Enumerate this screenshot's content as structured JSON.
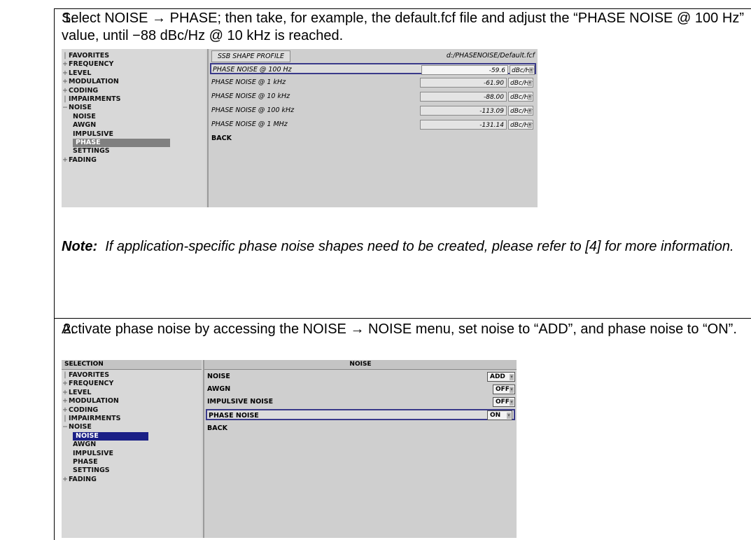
{
  "steps": [
    {
      "number": "1.",
      "text": "Select NOISE → PHASE; then take, for example, the default.fcf file and adjust the “PHASE NOISE @ 100 Hz” value, until −88 dBc/Hz @ 10 kHz is reached.",
      "note_label": "Note:",
      "note_text": "If application-specific phase noise shapes need to be created, please refer to [4] for more information."
    },
    {
      "number": "2.",
      "text": "Activate phase noise by accessing the NOISE → NOISE menu, set noise to “ADD”, and phase noise to “ON”."
    }
  ],
  "screen1": {
    "tree": [
      "FAVORITES",
      "FREQUENCY",
      "LEVEL",
      "MODULATION",
      "CODING",
      "IMPAIRMENTS",
      "NOISE",
      "NOISE",
      "AWGN",
      "IMPULSIVE",
      "PHASE",
      "SETTINGS",
      "FADING"
    ],
    "header_label": "SSB SHAPE PROFILE",
    "file_path": "d:/PHASENOISE/Default.fcf",
    "rows": [
      {
        "label": "PHASE NOISE @ 100 Hz",
        "value": "-59.6",
        "unit": "dBc/Hz"
      },
      {
        "label": "PHASE NOISE @ 1 kHz",
        "value": "-61.90",
        "unit": "dBc/Hz"
      },
      {
        "label": "PHASE NOISE @ 10 kHz",
        "value": "-88.00",
        "unit": "dBc/Hz"
      },
      {
        "label": "PHASE NOISE @ 100 kHz",
        "value": "-113.09",
        "unit": "dBc/Hz"
      },
      {
        "label": "PHASE NOISE @ 1 MHz",
        "value": "-131.14",
        "unit": "dBc/Hz"
      }
    ],
    "back_label": "BACK"
  },
  "screen2": {
    "selection_header": "SELECTION",
    "panel_title": "NOISE",
    "tree": [
      "FAVORITES",
      "FREQUENCY",
      "LEVEL",
      "MODULATION",
      "CODING",
      "IMPAIRMENTS",
      "NOISE",
      "NOISE",
      "AWGN",
      "IMPULSIVE",
      "PHASE",
      "SETTINGS",
      "FADING"
    ],
    "rows": [
      {
        "label": "NOISE",
        "value": "ADD"
      },
      {
        "label": "AWGN",
        "value": "OFF"
      },
      {
        "label": "IMPULSIVE NOISE",
        "value": "OFF"
      },
      {
        "label": "PHASE NOISE",
        "value": "ON"
      }
    ],
    "back_label": "BACK"
  }
}
